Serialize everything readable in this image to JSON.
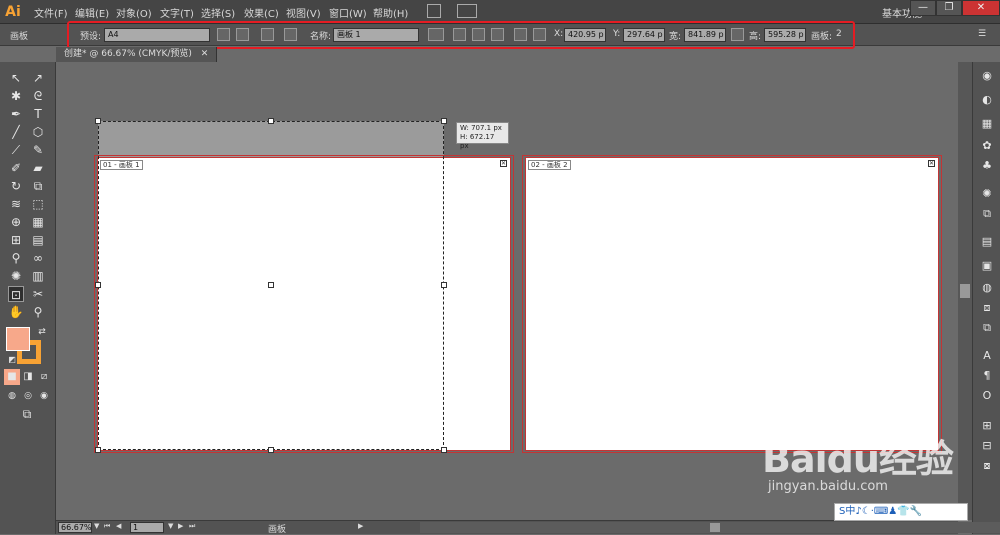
{
  "app": {
    "logo": "Ai",
    "workspace": "基本功能"
  },
  "menu": [
    "文件(F)",
    "编辑(E)",
    "对象(O)",
    "文字(T)",
    "选择(S)",
    "效果(C)",
    "视图(V)",
    "窗口(W)",
    "帮助(H)"
  ],
  "window_buttons": [
    "—",
    "❐",
    "✕"
  ],
  "control": {
    "panel_name": "画板",
    "preset_label": "预设:",
    "preset_value": "A4",
    "name_label": "名称:",
    "name_value": "画板 1",
    "x_label": "X:",
    "x_value": "420.95 p",
    "y_label": "Y:",
    "y_value": "297.64 p",
    "w_label": "宽:",
    "w_value": "841.89 p",
    "h_label": "高:",
    "h_value": "595.28 p",
    "artboards_label": "画板:",
    "artboards_value": "2"
  },
  "document": {
    "tab_label": "创建* @ 66.67% (CMYK/预览)",
    "tab_close": "✕"
  },
  "artboards": [
    {
      "label": "01 - 画板 1",
      "close": "✕"
    },
    {
      "label": "02 - 画板 2",
      "close": "✕"
    }
  ],
  "tooltip": {
    "w": "W: 707.1 px",
    "h": "H: 672.17 px"
  },
  "status": {
    "zoom": "66.67%",
    "page": "1",
    "tool_name": "画板"
  },
  "watermark": {
    "logo": "Baidu经验",
    "url": "jingyan.baidu.com"
  },
  "ime": {
    "text": "S中♪☾·⌨♟👕🔧"
  },
  "colors": {
    "fill": "#f7a88a",
    "stroke": "#f7a234",
    "highlight": "#e51c23",
    "artboard_border": "#c23535"
  }
}
